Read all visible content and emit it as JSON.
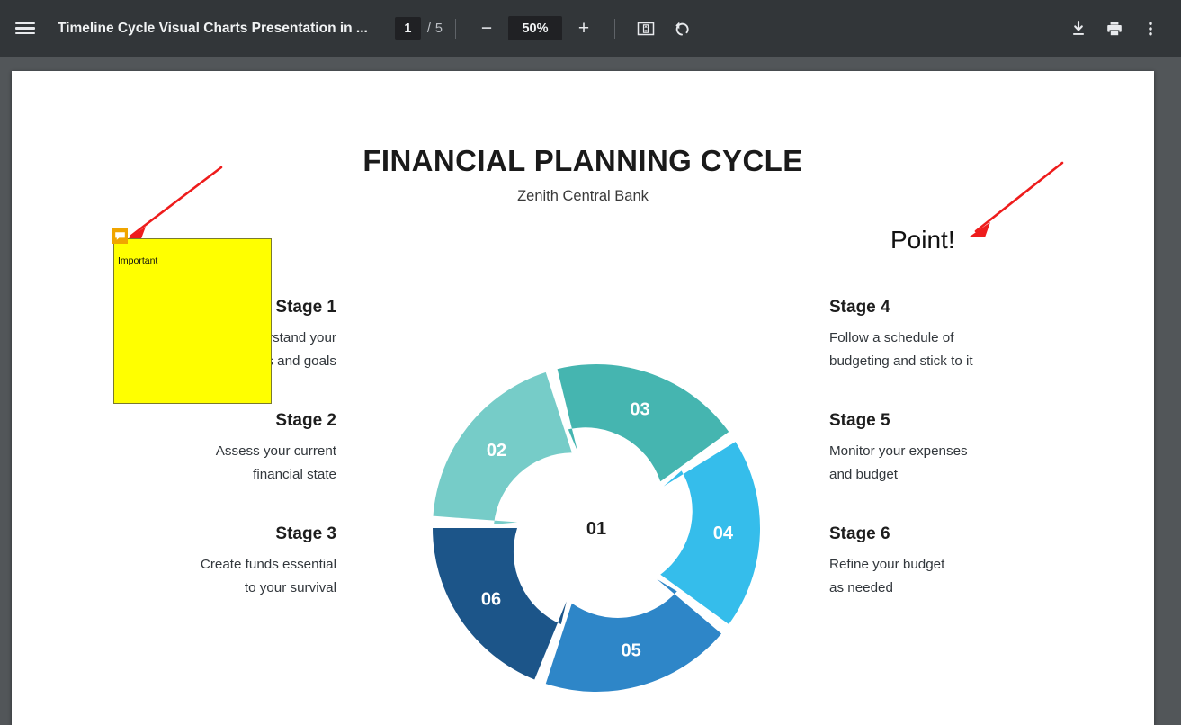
{
  "toolbar": {
    "menu_icon": "hamburger-menu-icon",
    "document_title": "Timeline Cycle Visual Charts Presentation in ...",
    "page_current": "1",
    "page_separator": "/",
    "page_total": "5",
    "zoom_out_label": "−",
    "zoom_value": "50%",
    "zoom_in_label": "+",
    "fit_icon": "fit-to-page-icon",
    "rotate_icon": "rotate-counterclockwise-icon",
    "download_icon": "download-icon",
    "print_icon": "print-icon",
    "more_icon": "more-options-icon",
    "bg_color": "#323639",
    "accent_color": "#202124"
  },
  "viewer": {
    "background_color": "#525659",
    "page_background": "#ffffff"
  },
  "slide": {
    "title": "FINANCIAL PLANNING CYCLE",
    "subtitle": "Zenith Central Bank",
    "left_stages": [
      {
        "heading": "Stage 1",
        "line1": "Understand your",
        "line2": "needs and goals"
      },
      {
        "heading": "Stage 2",
        "line1": "Assess your current",
        "line2": "financial state"
      },
      {
        "heading": "Stage 3",
        "line1": "Create funds essential",
        "line2": "to your survival"
      }
    ],
    "right_stages": [
      {
        "heading": "Stage 4",
        "line1": "Follow a schedule of",
        "line2": "budgeting and stick to it"
      },
      {
        "heading": "Stage 5",
        "line1": "Monitor your expenses",
        "line2": "and budget"
      },
      {
        "heading": "Stage 6",
        "line1": "Refine your budget",
        "line2": "as needed"
      }
    ]
  },
  "chart_data": {
    "type": "pie",
    "title": "FINANCIAL PLANNING CYCLE",
    "subtitle": "Zenith Central Bank",
    "center_label": "01",
    "center_color": "#ffffff",
    "legend": "none",
    "categories": [
      "02",
      "03",
      "04",
      "05",
      "06"
    ],
    "values": [
      20,
      20,
      20,
      20,
      20
    ],
    "colors": [
      "#76ccc8",
      "#45b5b0",
      "#35bdeb",
      "#2e86c8",
      "#1c5589"
    ],
    "segments": [
      {
        "label": "02",
        "color": "#76ccc8",
        "start_deg": 270,
        "end_deg": 342,
        "stage": "Stage 2"
      },
      {
        "label": "03",
        "color": "#45b5b0",
        "start_deg": 342,
        "end_deg": 54,
        "stage": "Stage 3"
      },
      {
        "label": "04",
        "color": "#35bdeb",
        "start_deg": 54,
        "end_deg": 126,
        "stage": "Stage 4"
      },
      {
        "label": "05",
        "color": "#2e86c8",
        "start_deg": 126,
        "end_deg": 198,
        "stage": "Stage 5"
      },
      {
        "label": "06",
        "color": "#1c5589",
        "start_deg": 198,
        "end_deg": 270,
        "stage": "Stage 6"
      }
    ]
  },
  "annotations": {
    "sticky_note": {
      "icon": "comment-note-icon",
      "text": "Important",
      "fill_color": "#ffff00",
      "icon_color": "#f0a500"
    },
    "text_note": {
      "text": "Point!",
      "color": "#111111"
    },
    "arrows": {
      "color": "#ee1c1c",
      "count": 2
    }
  }
}
